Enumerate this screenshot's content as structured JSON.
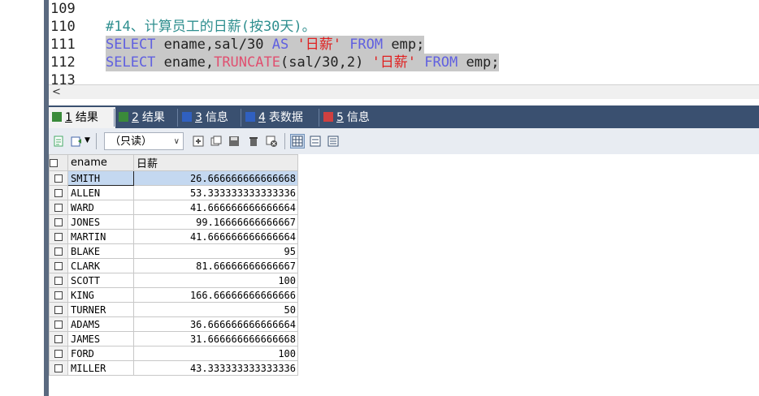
{
  "editor": {
    "lines": [
      {
        "num": "109",
        "code": ""
      },
      {
        "num": "110",
        "comment": "#14、计算员工的日薪(按30天)。"
      },
      {
        "num": "111",
        "parts": [
          {
            "t": "SELECT",
            "c": "kw"
          },
          {
            "t": " ename,sal/30 ",
            "c": "pl"
          },
          {
            "t": "AS",
            "c": "kw"
          },
          {
            "t": " ",
            "c": "pl"
          },
          {
            "t": "'日薪'",
            "c": "str"
          },
          {
            "t": " ",
            "c": "pl"
          },
          {
            "t": "FROM",
            "c": "kw"
          },
          {
            "t": " emp;",
            "c": "pl"
          }
        ]
      },
      {
        "num": "112",
        "parts": [
          {
            "t": "SELECT",
            "c": "kw"
          },
          {
            "t": " ename,",
            "c": "pl"
          },
          {
            "t": "TRUNCATE",
            "c": "fn"
          },
          {
            "t": "(sal/30,2) ",
            "c": "pl"
          },
          {
            "t": "'日薪'",
            "c": "str"
          },
          {
            "t": " ",
            "c": "pl"
          },
          {
            "t": "FROM",
            "c": "kw"
          },
          {
            "t": " emp;",
            "c": "pl"
          }
        ]
      },
      {
        "num": "113",
        "code": ""
      }
    ],
    "scroll_left": "<"
  },
  "tabs": [
    {
      "num": "1",
      "label": "结果",
      "icon": "result-grid-icon",
      "color": "#3a8a3a"
    },
    {
      "num": "2",
      "label": "结果",
      "icon": "result-grid-icon",
      "color": "#3a8a3a"
    },
    {
      "num": "3",
      "label": "信息",
      "icon": "info-icon",
      "color": "#3060c0"
    },
    {
      "num": "4",
      "label": "表数据",
      "icon": "table-data-icon",
      "color": "#3060c0"
    },
    {
      "num": "5",
      "label": "信息",
      "icon": "info-multi-icon",
      "color": "#d04040"
    }
  ],
  "toolbar": {
    "mode_select": "（只读）"
  },
  "grid": {
    "columns": [
      "ename",
      "日薪"
    ],
    "rows": [
      {
        "ename": "SMITH",
        "salary": "26.666666666666668"
      },
      {
        "ename": "ALLEN",
        "salary": "53.333333333333336"
      },
      {
        "ename": "WARD",
        "salary": "41.666666666666664"
      },
      {
        "ename": "JONES",
        "salary": "99.16666666666667"
      },
      {
        "ename": "MARTIN",
        "salary": "41.666666666666664"
      },
      {
        "ename": "BLAKE",
        "salary": "95"
      },
      {
        "ename": "CLARK",
        "salary": "81.66666666666667"
      },
      {
        "ename": "SCOTT",
        "salary": "100"
      },
      {
        "ename": "KING",
        "salary": "166.66666666666666"
      },
      {
        "ename": "TURNER",
        "salary": "50"
      },
      {
        "ename": "ADAMS",
        "salary": "36.666666666666664"
      },
      {
        "ename": "JAMES",
        "salary": "31.666666666666668"
      },
      {
        "ename": "FORD",
        "salary": "100"
      },
      {
        "ename": "MILLER",
        "salary": "43.333333333333336"
      }
    ]
  },
  "colors": {
    "keyword": "#6060e0",
    "function": "#e05070",
    "string": "#e02020",
    "comment": "#2f8f8f",
    "selection": "#c8c8c8",
    "tabbar": "#3a5070",
    "row_highlight": "#c4d8f0"
  }
}
